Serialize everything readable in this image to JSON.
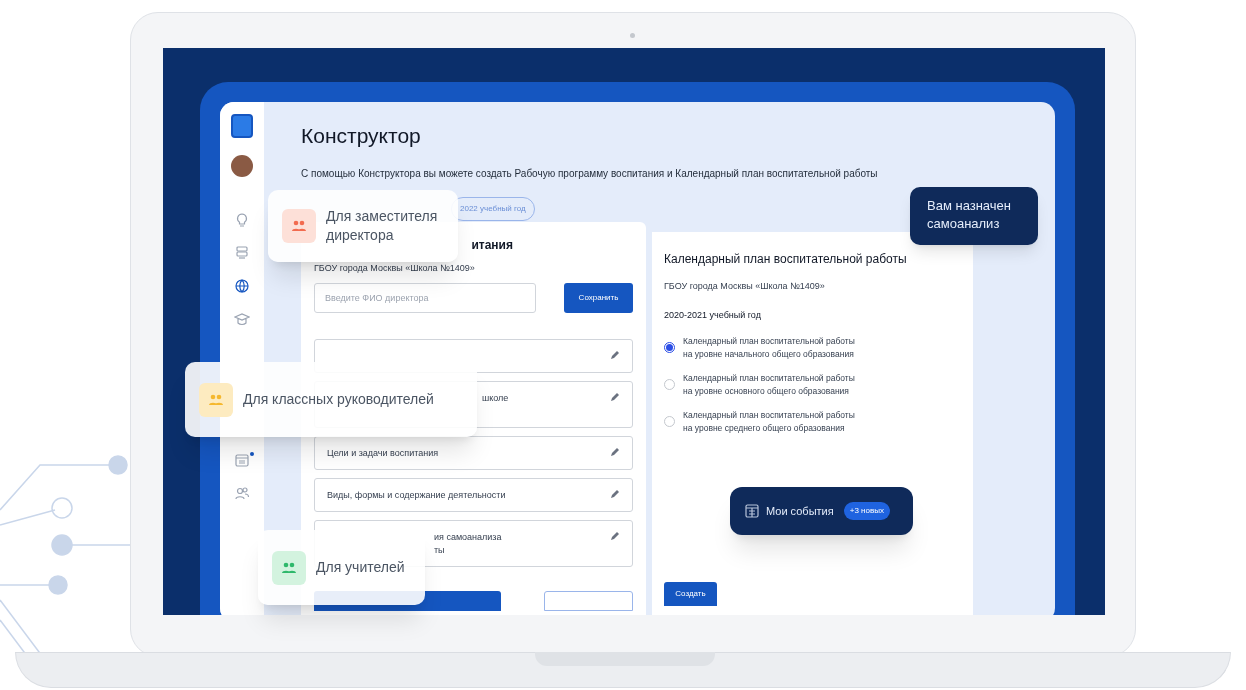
{
  "page": {
    "title": "Конструктор",
    "description": "С помощью Конструктора вы можете создать Рабочую программу воспитания и Календарный план воспитательной работы",
    "year_chip": "2022 учебный год"
  },
  "sidebar_items": [
    {
      "kind": "lightbulb",
      "has_dot": false
    },
    {
      "kind": "stack",
      "has_dot": false
    },
    {
      "kind": "globe",
      "has_dot": false
    },
    {
      "kind": "cap",
      "has_dot": false
    },
    {
      "kind": "calendar",
      "has_dot": true
    },
    {
      "kind": "people",
      "has_dot": false
    }
  ],
  "program_card": {
    "title_fragment": "итания",
    "school": "ГБОУ города Москвы «Школа №1409»",
    "director_placeholder": "Введите ФИО директора",
    "save_button": "Сохранить",
    "sections": [
      {
        "kind": "single"
      },
      {
        "kind": "double",
        "lines": [
          "школе"
        ]
      },
      {
        "kind": "single",
        "lines": [
          "Цели и задачи воспитания"
        ]
      },
      {
        "kind": "single",
        "lines": [
          "Виды, формы и содержание деятельности"
        ]
      },
      {
        "kind": "double",
        "lines": [
          "ия самоанализа",
          "ты"
        ]
      }
    ]
  },
  "calendar_card": {
    "title": "Календарный план воспитательной работы",
    "school": "ГБОУ города Москвы «Школа №1409»",
    "year": "2020-2021 учебный год",
    "options": [
      {
        "label": "Календарный план воспитательной работы\nна уровне начального общего образования",
        "selected": true
      },
      {
        "label": "Календарный план воспитательной работы\nна уровне основного общего образования",
        "selected": false
      },
      {
        "label": "Календарный план воспитательной работы\nна уровне среднего общего образования",
        "selected": false
      }
    ],
    "create_button": "Создать"
  },
  "notice": "Вам назначен\nсамоанализ",
  "events": {
    "label": "Мои события",
    "badge": "+3 новых"
  },
  "audience_cards": [
    {
      "label": "Для заместителя\nдиректора",
      "color": "#f26b4f"
    },
    {
      "label": "Для классных руководителей",
      "color": "#f5b82e"
    },
    {
      "label": "Для учителей",
      "color": "#2fb86b"
    }
  ]
}
